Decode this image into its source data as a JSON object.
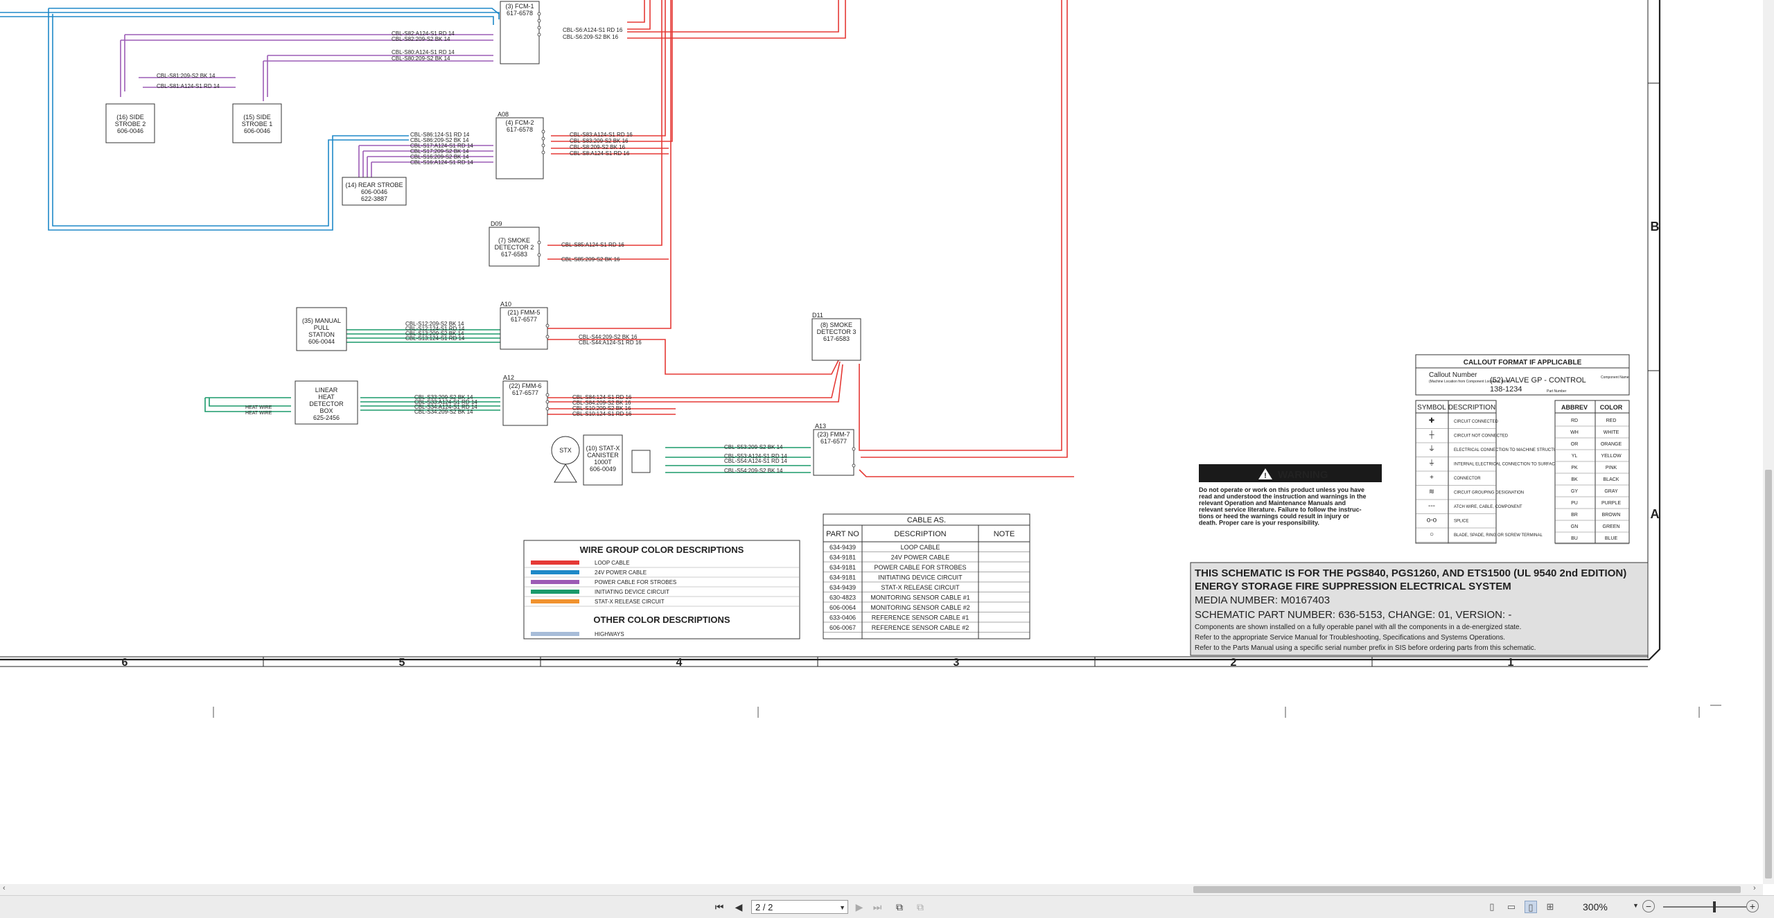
{
  "schematic": {
    "grid_columns": [
      "6",
      "5",
      "4",
      "3",
      "2",
      "1"
    ],
    "grid_rows": [
      "B",
      "A"
    ],
    "modules": {
      "fcm1": {
        "title": "(3) FCM-1",
        "pn": "617-6578"
      },
      "fcm2": {
        "ref": "A08",
        "title": "(4) FCM-2",
        "pn": "617-6578"
      },
      "strobe2": {
        "l1": "(16) SIDE",
        "l2": "STROBE 2",
        "l3": "606-0046"
      },
      "strobe1": {
        "l1": "(15) SIDE",
        "l2": "STROBE 1",
        "l3": "606-0046"
      },
      "rear_strobe": {
        "l1": "(14) REAR STROBE",
        "l2": "606-0046",
        "l3": "622-3887"
      },
      "smoke2": {
        "ref": "D09",
        "l1": "(7) SMOKE",
        "l2": "DETECTOR 2",
        "l3": "617-6583"
      },
      "smoke3": {
        "ref": "D11",
        "l1": "(8) SMOKE",
        "l2": "DETECTOR 3",
        "l3": "617-6583"
      },
      "manual": {
        "l1": "(35) MANUAL",
        "l2": "PULL",
        "l3": "STATION",
        "l4": "606-0044"
      },
      "fmm5": {
        "ref": "A10",
        "l1": "(21) FMM-5",
        "l2": "617-6577"
      },
      "linear": {
        "l1": "LINEAR",
        "l2": "HEAT",
        "l3": "DETECTOR",
        "l4": "BOX",
        "l5": "625-2456"
      },
      "fmm6": {
        "ref": "A12",
        "l1": "(22) FMM-6",
        "l2": "617-6577"
      },
      "fmm7": {
        "ref": "A13",
        "l1": "(23) FMM-7",
        "l2": "617-6577"
      },
      "statx": {
        "sym": "STX",
        "l1": "(10) STAT-X",
        "l2": "CANISTER",
        "l3": "1000T",
        "l4": "606-0049"
      }
    },
    "cable_labels": {
      "fcm1_left": [
        "CBL-S82:A124-S1 RD 14",
        "CBL-S82:209-S2 BK 14",
        "CBL-S80:A124-S1 RD 14",
        "CBL-S80:209-S2 BK 14"
      ],
      "fcm1_right": [
        "CBL-S6:A124-S1 RD 16",
        "CBL-S6:209-S2 BK 16"
      ],
      "strobes": [
        "CBL-S81:209-S2 BK 14",
        "CBL-S81:A124-S1 RD 14"
      ],
      "fcm2_left": [
        "CBL-S86:124-S1 RD 14",
        "CBL-S86:209-S2 BK 14",
        "CBL-S17:A124-S1 RD 14",
        "CBL-S17:209-S2 BK 14",
        "CBL-S16:209-S2 BK 14",
        "CBL-S16:A124-S1 RD 14"
      ],
      "fcm2_right": [
        "CBL-S83:A124-S1 RD 16",
        "CBL-S83:209-S2 BK 16",
        "CBL-S8:209-S2 BK 16",
        "CBL-S8:A124-S1 RD 16"
      ],
      "smoke2_right": [
        "CBL-S85:A124-S1 RD 16",
        "CBL-S85:209-S2 BK 16"
      ],
      "fmm5_left": [
        "CBL-S12:209-S2 BK 14",
        "CBL-S12:124-S1 RD 14",
        "CBL-S13:209-S2 BK 14",
        "CBL-S13:124-S1 RD 14"
      ],
      "fmm5_right": [
        "CBL-S44:209-S2 BK 16",
        "CBL-S44:A124-S1 RD 16"
      ],
      "fmm6_left": [
        "CBL-S33:209-S2 BK 14",
        "CBL-S33:A124-S1 RD 14",
        "CBL-S34:A124-S1 RD 14",
        "CBL-S34:209-S2 BK 14"
      ],
      "fmm6_right": [
        "CBL-S84:124-S1 RD 16",
        "CBL-S84:209-S2 BK 16",
        "CBL-S10:209-S2 BK 16",
        "CBL-S10:124-S1 RD 16"
      ],
      "heat_wire": [
        "HEAT WIRE",
        "HEAT WIRE"
      ],
      "fmm7_left": [
        "CBL-S53:209-S2 BK 14",
        "CBL-S53:A124-S1 RD 14",
        "CBL-S54:A124-S1 RD 14",
        "CBL-S54:209-S2 BK 14"
      ]
    },
    "wire_group": {
      "title": "WIRE GROUP COLOR DESCRIPTIONS",
      "items": [
        {
          "color": "#e53935",
          "label": "LOOP CABLE"
        },
        {
          "color": "#1e88c8",
          "label": "24V POWER CABLE"
        },
        {
          "color": "#9c5bb5",
          "label": "POWER CABLE FOR STROBES"
        },
        {
          "color": "#1a9a6a",
          "label": "INITIATING DEVICE CIRCUIT"
        },
        {
          "color": "#f0922e",
          "label": "STAT-X RELEASE CIRCUIT"
        }
      ],
      "other_title": "OTHER COLOR DESCRIPTIONS",
      "other_items": [
        {
          "color": "#a7bcd8",
          "label": "HIGHWAYS"
        }
      ]
    },
    "cable_table": {
      "title": "CABLE AS.",
      "headers": [
        "PART NO",
        "DESCRIPTION",
        "NOTE"
      ],
      "rows": [
        [
          "634-9439",
          "LOOP CABLE",
          ""
        ],
        [
          "634-9181",
          "24V POWER CABLE",
          ""
        ],
        [
          "634-9181",
          "POWER CABLE FOR STROBES",
          ""
        ],
        [
          "634-9181",
          "INITIATING DEVICE CIRCUIT",
          ""
        ],
        [
          "634-9439",
          "STAT-X RELEASE CIRCUIT",
          ""
        ],
        [
          "630-4823",
          "MONITORING SENSOR CABLE #1",
          ""
        ],
        [
          "606-0064",
          "MONITORING SENSOR CABLE #2",
          ""
        ],
        [
          "633-0406",
          "REFERENCE SENSOR CABLE #1",
          ""
        ],
        [
          "606-0067",
          "REFERENCE SENSOR CABLE #2",
          ""
        ]
      ]
    },
    "warning": {
      "title": "WARNING",
      "lines": [
        "Do not operate or work on this product unless you have",
        "read and understood the instruction and warnings in the",
        "relevant Operation and Maintenance Manuals and",
        "relevant service literature. Failure to follow the instruc-",
        "tions or heed the warnings could result in injury or",
        "death. Proper care is your responsibility."
      ]
    },
    "callout": {
      "title": "CALLOUT FORMAT IF APPLICABLE",
      "callout_number": "Callout Number",
      "callout_sub": "(Machine Location from Component Locations Table)",
      "example": "(52) VALVE GP - CONTROL",
      "example_pn": "138-1234",
      "component_name": "Component Name",
      "part_number": "Part Number"
    },
    "symbols": {
      "headers": [
        "SYMBOL",
        "DESCRIPTION"
      ],
      "rows": [
        "CIRCUIT CONNECTED",
        "CIRCUIT NOT CONNECTED",
        "ELECTRICAL CONNECTION TO MACHINE STRUCTURE",
        "INTERNAL ELECTRICAL CONNECTION TO SURFACE OF COMPONENT",
        "CONNECTOR",
        "CIRCUIT GROUPING DESIGNATION",
        "ATCH WIRE, CABLE, COMPONENT",
        "SPLICE",
        "BLADE, SPADE, RING OR SCREW TERMINAL"
      ]
    },
    "colors_table": {
      "headers": [
        "ABBREV",
        "COLOR"
      ],
      "rows": [
        [
          "RD",
          "RED"
        ],
        [
          "WH",
          "WHITE"
        ],
        [
          "OR",
          "ORANGE"
        ],
        [
          "YL",
          "YELLOW"
        ],
        [
          "PK",
          "PINK"
        ],
        [
          "BK",
          "BLACK"
        ],
        [
          "GY",
          "GRAY"
        ],
        [
          "PU",
          "PURPLE"
        ],
        [
          "BR",
          "BROWN"
        ],
        [
          "GN",
          "GREEN"
        ],
        [
          "BU",
          "BLUE"
        ]
      ]
    },
    "title_block": {
      "line1": "THIS SCHEMATIC IS FOR THE PGS840, PGS1260, AND ETS1500 (UL 9540 2nd EDITION)",
      "line2": "ENERGY STORAGE FIRE SUPPRESSION ELECTRICAL SYSTEM",
      "media": "MEDIA NUMBER: M0167403",
      "partnum": "SCHEMATIC PART NUMBER: 636-5153, CHANGE: 01, VERSION: -",
      "notes": [
        "Components are shown installed on a fully operable panel with all the components in a de-energized state.",
        "Refer to the appropriate Service Manual for Troubleshooting, Specifications and Systems Operations.",
        "Refer to the Parts Manual using a specific serial number prefix in SIS before ordering parts from this schematic."
      ]
    }
  },
  "toolbar": {
    "page_value": "2 / 2",
    "zoom": "300%"
  }
}
